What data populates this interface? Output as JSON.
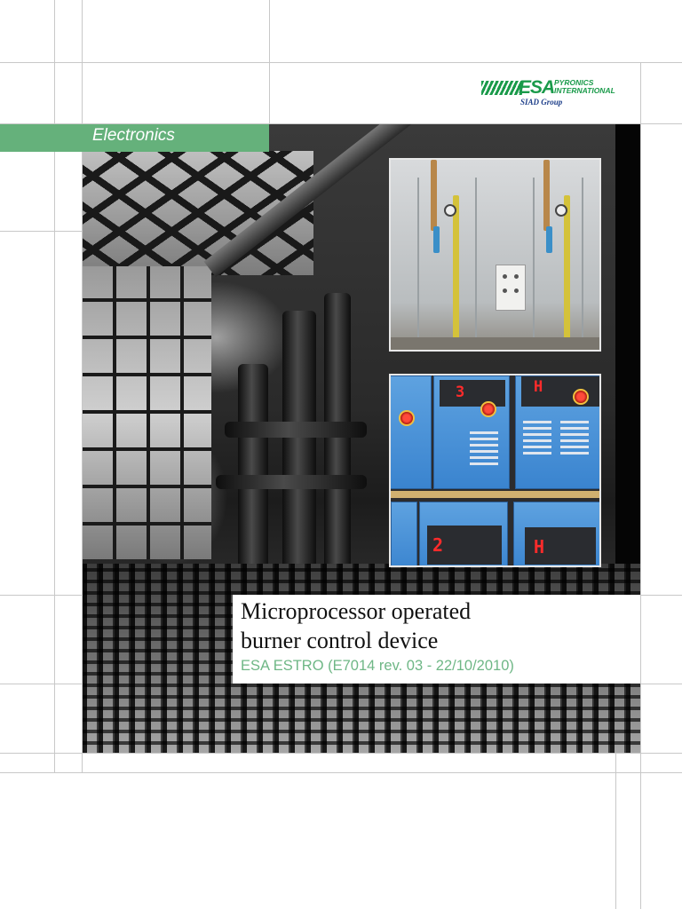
{
  "logo": {
    "esa": "ESA",
    "pyronics_line1": "PYRONICS",
    "pyronics_line2": "INTERNATIONAL",
    "group": "SIAD Group"
  },
  "category": {
    "label": "Electronics"
  },
  "title": {
    "line1": "Microprocessor operated",
    "line2": "burner control device"
  },
  "subtitle": "ESA ESTRO (E7014 rev. 03 - 22/10/2010)",
  "photos": {
    "display_top_left": "3",
    "display_top_right": "H",
    "display_bottom_left": "2",
    "display_bottom_right": "H"
  },
  "colors": {
    "brand_green": "#1a9a4a",
    "tab_green": "#65b17b",
    "subtitle_green": "#6fb786",
    "group_blue": "#1e3f8a"
  }
}
